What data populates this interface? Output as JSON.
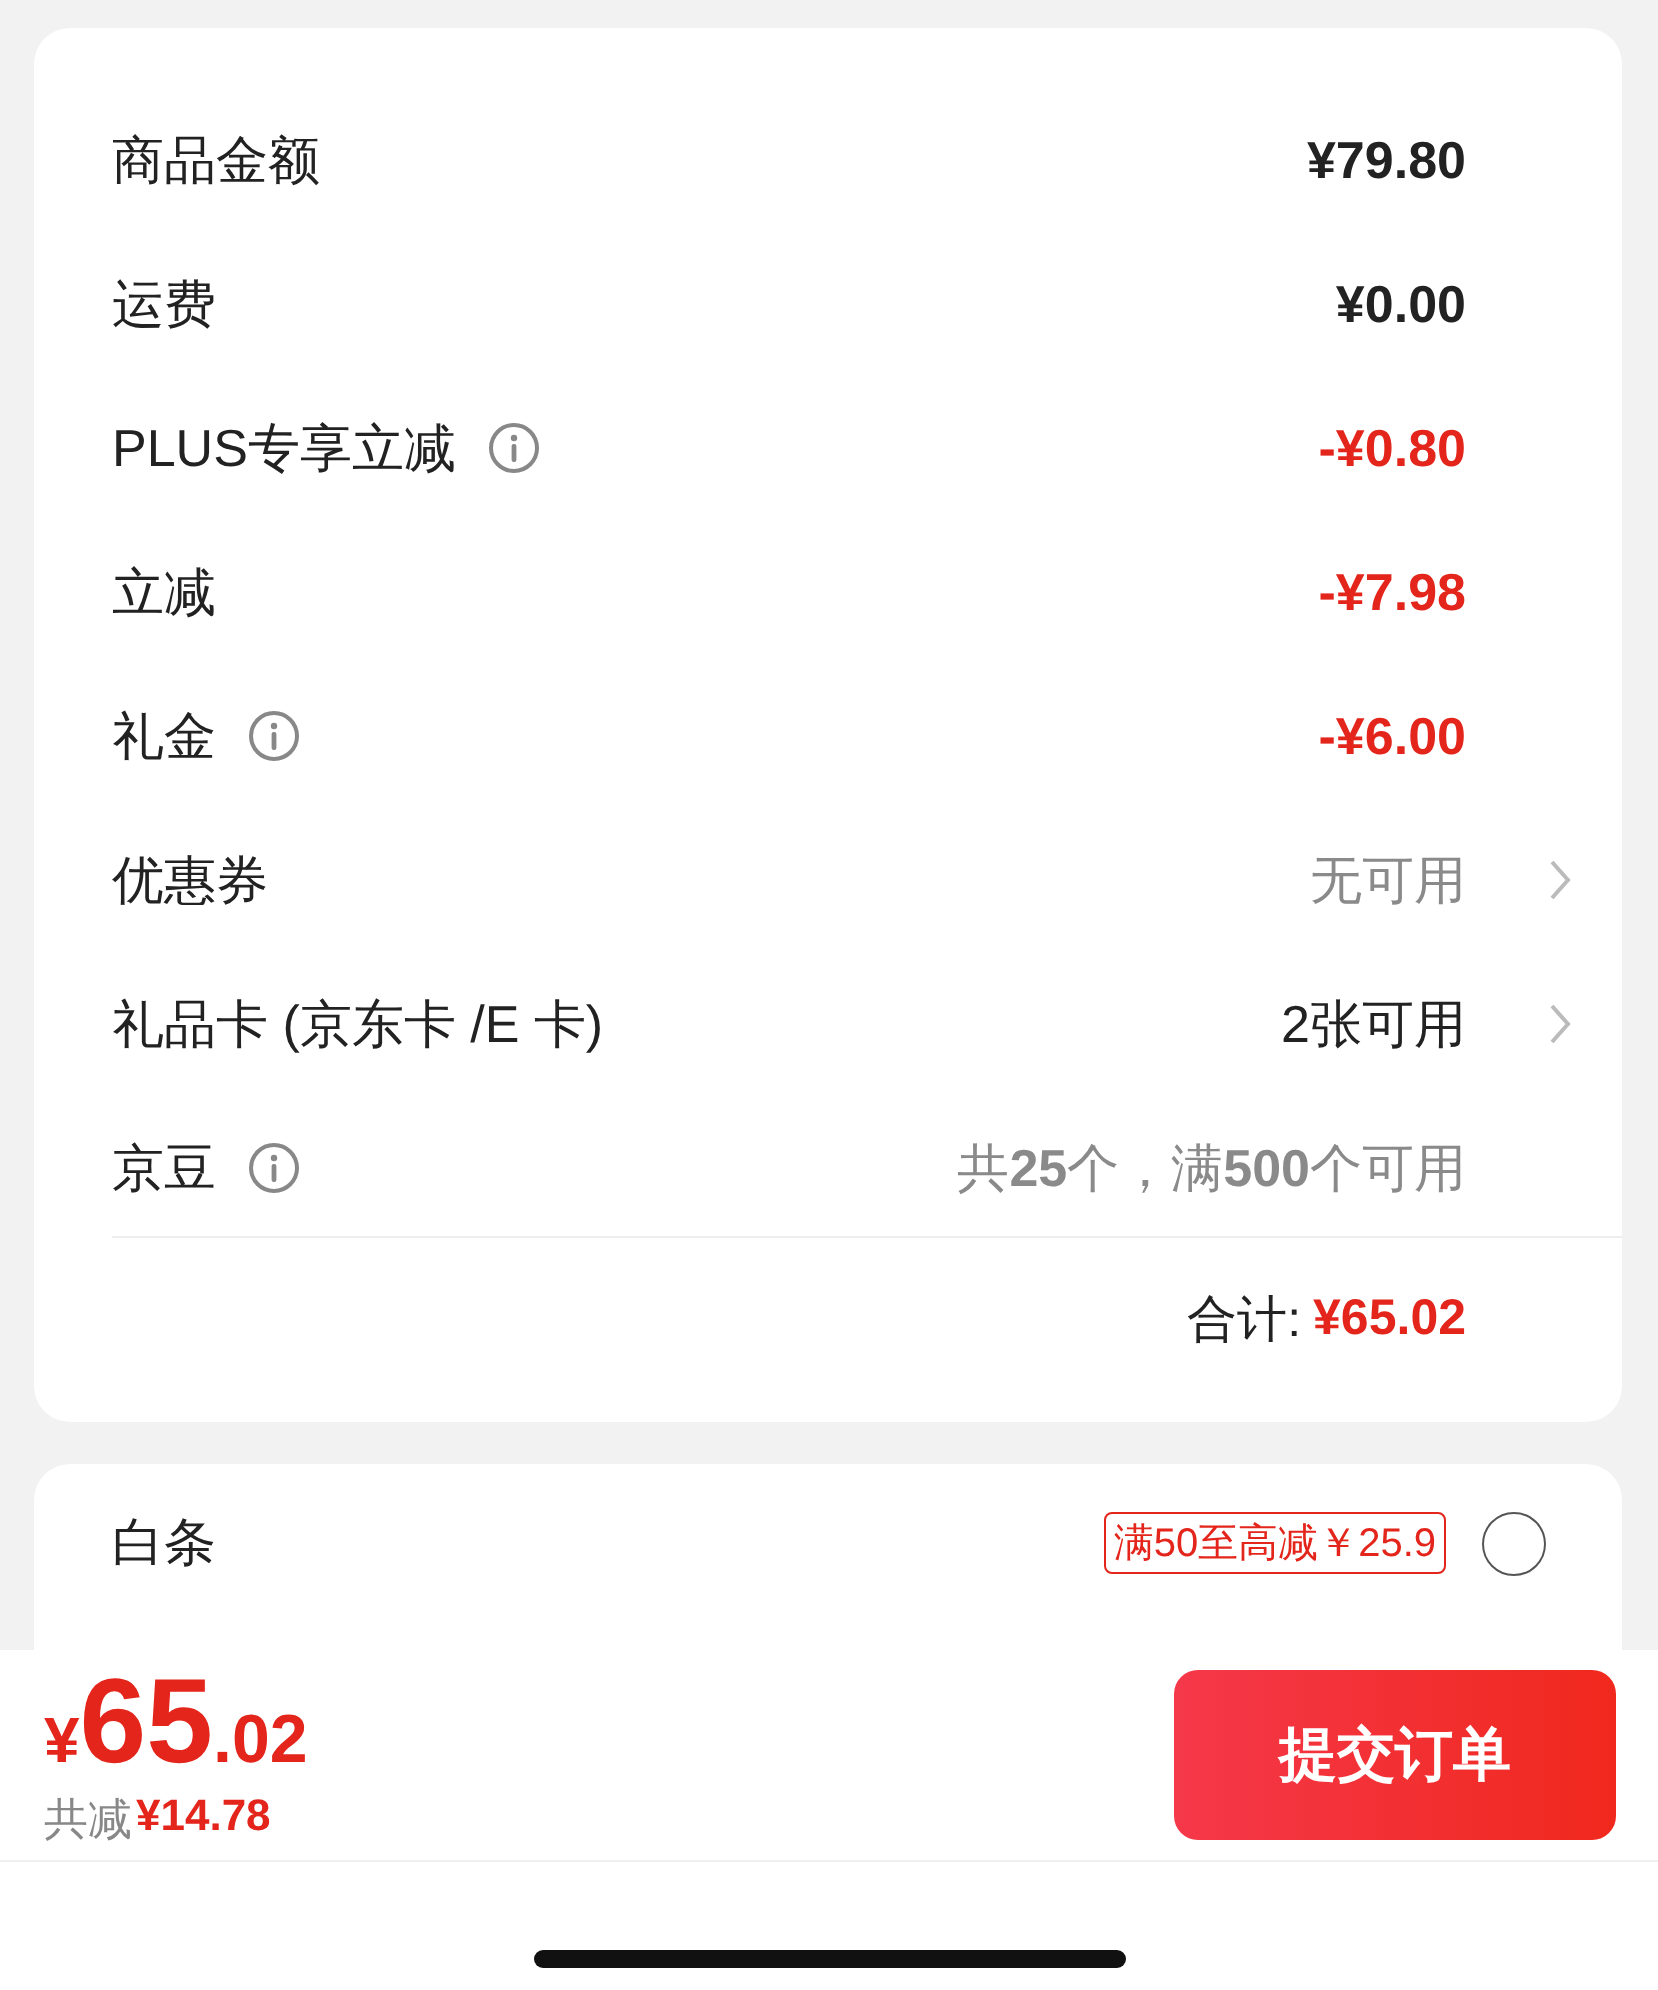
{
  "summary": {
    "rows": [
      {
        "label": "商品金额",
        "info": false,
        "value": "¥79.80",
        "kind": "amount",
        "chevron": false
      },
      {
        "label": "运费",
        "info": false,
        "value": "¥0.00",
        "kind": "amount",
        "chevron": false
      },
      {
        "label": "PLUS专享立减",
        "info": true,
        "value": "-¥0.80",
        "kind": "discount",
        "chevron": false
      },
      {
        "label": "立减",
        "info": false,
        "value": "-¥7.98",
        "kind": "discount",
        "chevron": false
      },
      {
        "label": "礼金",
        "info": true,
        "value": "-¥6.00",
        "kind": "discount",
        "chevron": false
      },
      {
        "label": "优惠券",
        "info": false,
        "value": "无可用",
        "kind": "muted",
        "chevron": true
      },
      {
        "label": "礼品卡 (京东卡 /E 卡)",
        "info": false,
        "value": "2张可用",
        "kind": "available",
        "chevron": true
      },
      {
        "label": "京豆",
        "info": true,
        "value": "共**25**个，满**500**个可用",
        "kind": "muted",
        "chevron": false
      }
    ],
    "total": {
      "label": "合计:",
      "value": "¥65.02"
    }
  },
  "payment": {
    "label": "白条",
    "promo": "满50至高减￥25.9",
    "selected": false
  },
  "checkout": {
    "currency": "¥",
    "price_integer": "65",
    "price_decimal": ".02",
    "saved_label": "共减",
    "saved_amount": "¥14.78",
    "submit": "提交订单"
  }
}
